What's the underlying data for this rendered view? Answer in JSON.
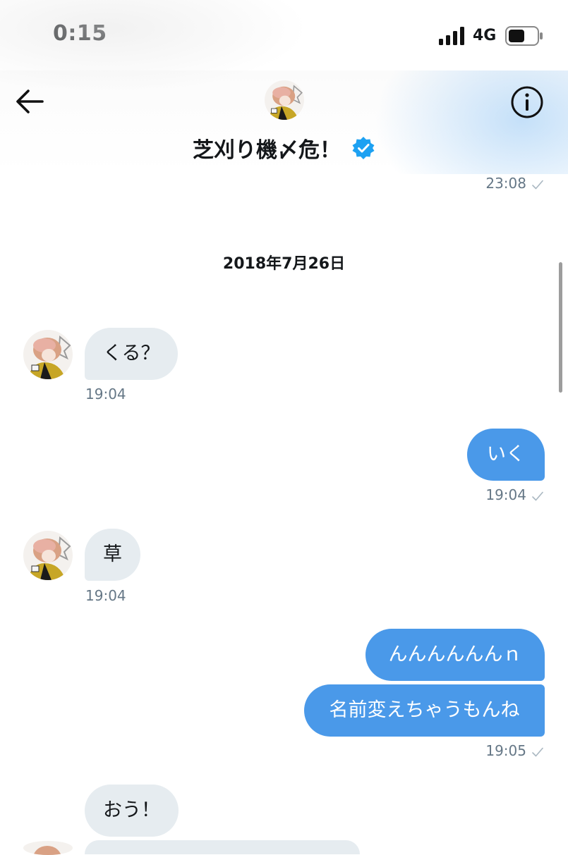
{
  "status_bar": {
    "time": "0:15",
    "network": "4G",
    "icons": [
      "signal-icon",
      "battery-icon"
    ]
  },
  "header": {
    "title": "芝刈り機〆危！",
    "icons": [
      "back-arrow-icon",
      "avatar",
      "verified-badge-icon",
      "info-icon"
    ],
    "accent_color": "#1da1f2"
  },
  "conversation": {
    "top_timestamp": "23:08",
    "date_divider": "2018年7月26日",
    "messages": [
      {
        "direction": "received",
        "text": "くる？",
        "time": "19:04"
      },
      {
        "direction": "sent",
        "text": "いく",
        "time": "19:04"
      },
      {
        "direction": "received",
        "text": "草",
        "time": "19:04"
      },
      {
        "direction": "sent",
        "text": "んんんんんんｎ"
      },
      {
        "direction": "sent",
        "text": "名前変えちゃうもんね",
        "time": "19:05"
      },
      {
        "direction": "received",
        "text": "おう！"
      }
    ]
  },
  "colors": {
    "sent_bubble": "#4a99e9",
    "received_bubble": "#e6ecf0",
    "timestamp": "#657786",
    "verified_badge": "#1da1f2"
  }
}
